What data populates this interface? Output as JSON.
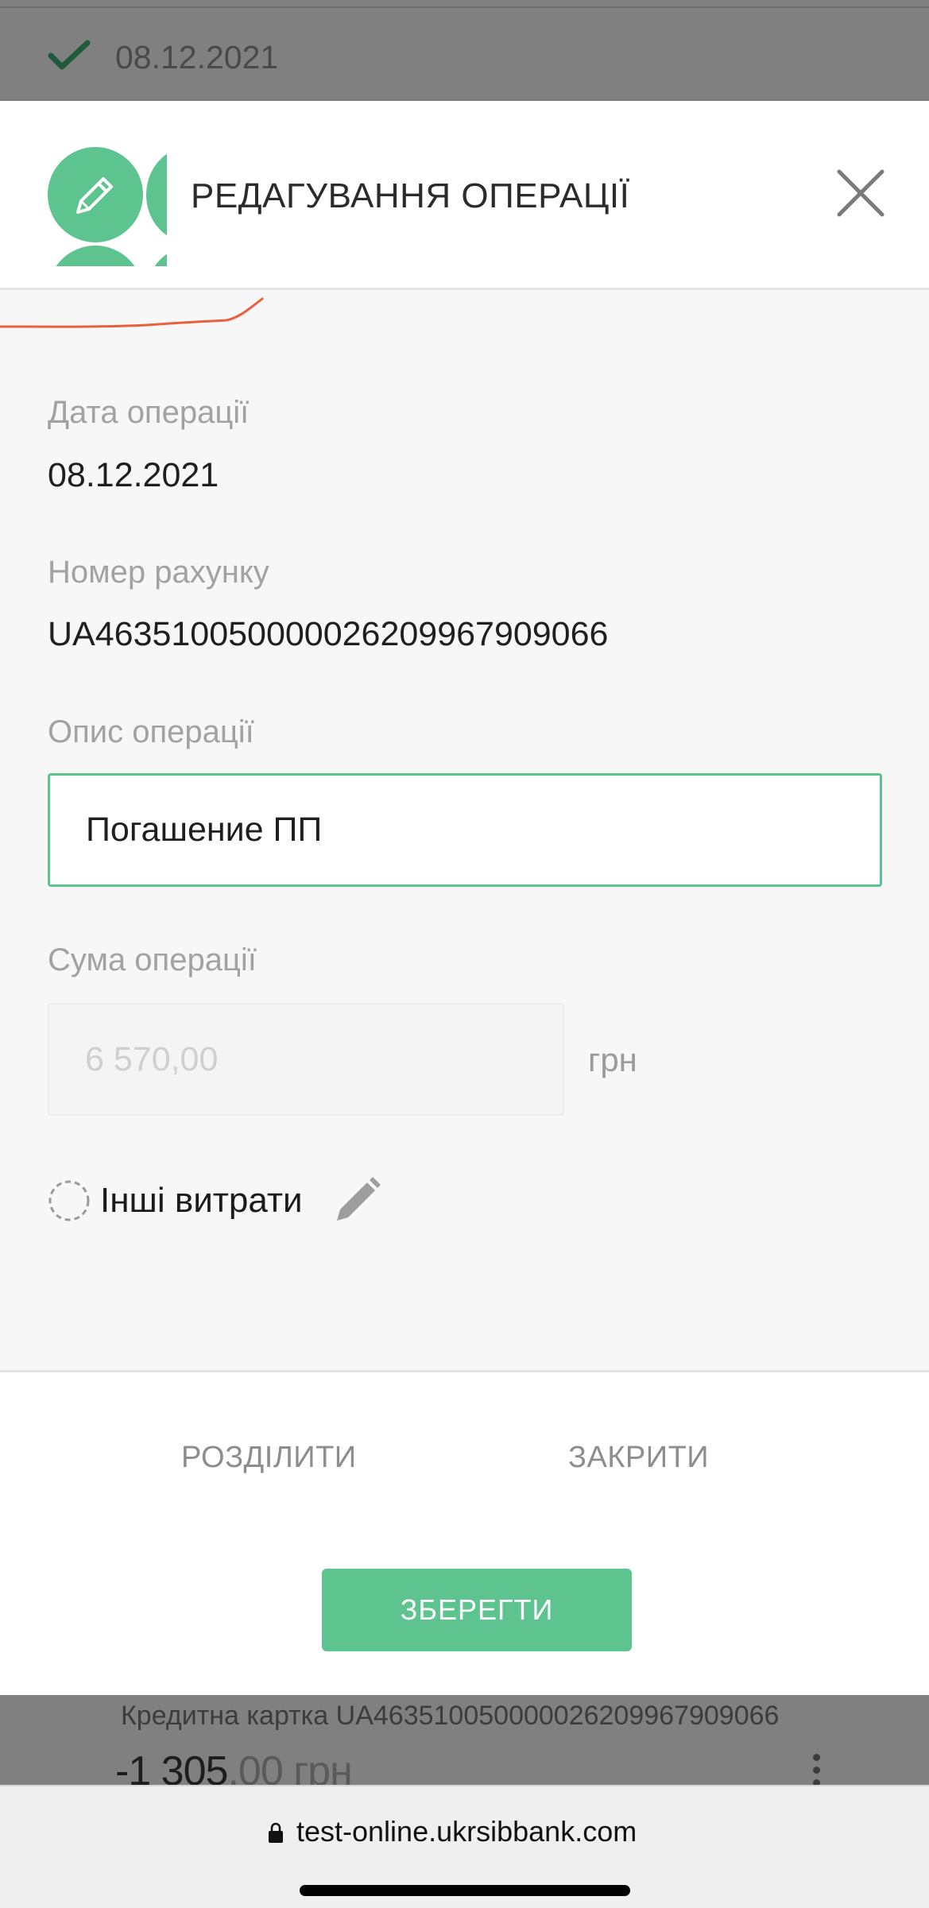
{
  "background": {
    "top_date": "08.12.2021",
    "card_line": "Кредитна картка UA463510050000026209967909066",
    "amount_main": "-1 305",
    "amount_decimals": ",00 грн"
  },
  "modal": {
    "title": "РЕДАГУВАННЯ ОПЕРАЦІЇ",
    "accent_color": "#5dc48f",
    "fields": {
      "date_label": "Дата операції",
      "date_value": "08.12.2021",
      "account_label": "Номер рахунку",
      "account_value": "UA463510050000026209967909066",
      "description_label": "Опис операції",
      "description_value": "Погашение ПП",
      "sum_label": "Сума операції",
      "sum_placeholder": "6 570,00",
      "currency": "грн",
      "category": "Інші витрати"
    },
    "buttons": {
      "split": "РОЗДІЛИТИ",
      "close": "ЗАКРИТИ",
      "save": "ЗБЕРЕГТИ"
    }
  },
  "browser": {
    "url": "test-online.ukrsibbank.com"
  }
}
